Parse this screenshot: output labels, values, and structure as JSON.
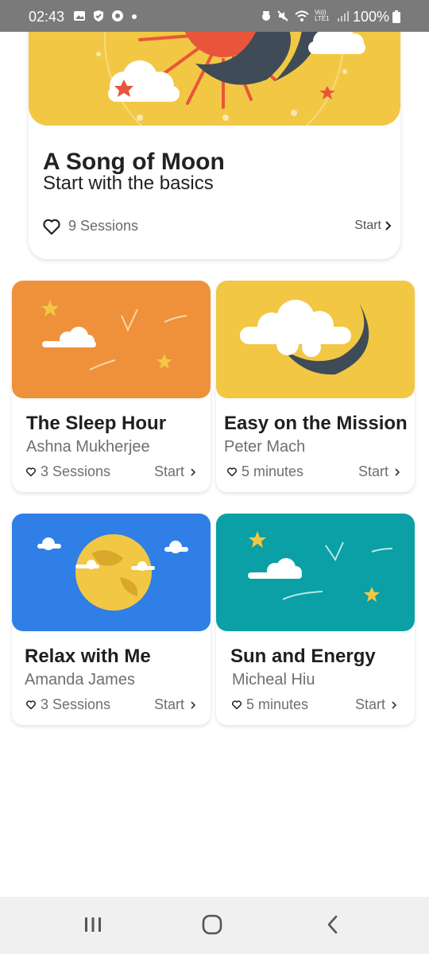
{
  "status_bar": {
    "time": "02:43",
    "battery": "100%",
    "network_label": "Vo)) LTE1",
    "icons": [
      "gallery-icon",
      "shield-check-icon",
      "app-icon",
      "dot-icon",
      "alarm-icon",
      "mute-icon",
      "wifi-icon",
      "signal-icon",
      "battery-icon"
    ]
  },
  "featured": {
    "title": "A Song of Moon",
    "subtitle": "Start with the basics",
    "sessions": "9 Sessions",
    "start_label": "Start",
    "colors": {
      "background": "#f2c744",
      "sun": "#e8553a",
      "moon": "#3f4b57"
    }
  },
  "cards": [
    {
      "title": "The Sleep Hour",
      "author": "Ashna Mukherjee",
      "meta": "3 Sessions",
      "start_label": "Start",
      "color": "#ef913a"
    },
    {
      "title": "Easy on the Mission",
      "author": "Peter Mach",
      "meta": "5 minutes",
      "start_label": "Start",
      "color": "#f2c744"
    },
    {
      "title": "Relax with Me",
      "author": "Amanda James",
      "meta": "3 Sessions",
      "start_label": "Start",
      "color": "#2f7fe6"
    },
    {
      "title": "Sun and Energy",
      "author": "Micheal Hiu",
      "meta": "5 minutes",
      "start_label": "Start",
      "color": "#0aa0a5"
    }
  ],
  "nav_bar": {
    "buttons": [
      "recent-apps-icon",
      "home-icon",
      "back-icon"
    ]
  }
}
